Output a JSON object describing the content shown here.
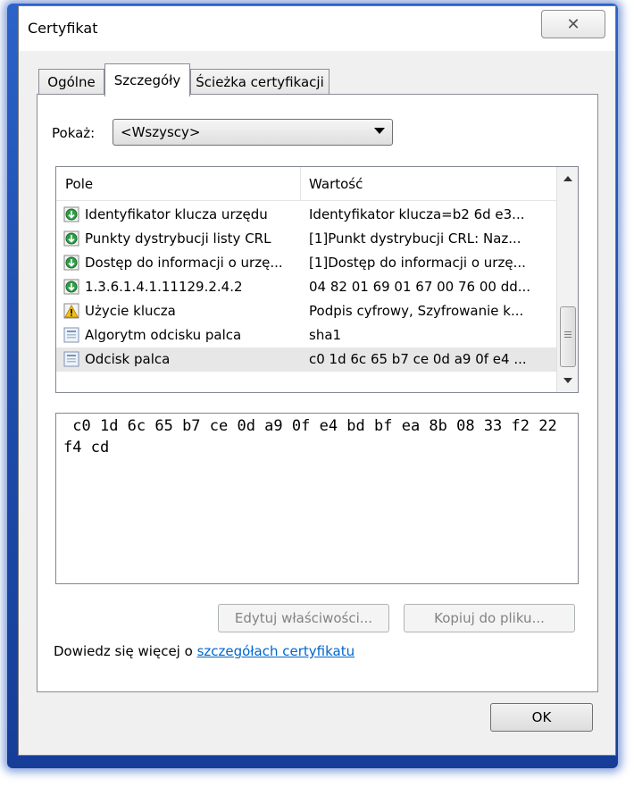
{
  "window": {
    "title": "Certyfikat",
    "close_glyph": "✕"
  },
  "tabs": [
    {
      "label": "Ogólne"
    },
    {
      "label": "Szczegóły",
      "active": true
    },
    {
      "label": "Ścieżka certyfikacji"
    }
  ],
  "show": {
    "label": "Pokaż:",
    "value": "<Wszyscy>"
  },
  "list": {
    "columns": [
      "Pole",
      "Wartość"
    ],
    "rows": [
      {
        "icon": "cert-extension-icon",
        "field": "Identyfikator klucza urzędu",
        "value": "Identyfikator klucza=b2 6d e3..."
      },
      {
        "icon": "cert-extension-icon",
        "field": "Punkty dystrybucji listy CRL",
        "value": "[1]Punkt dystrybucji CRL: Naz..."
      },
      {
        "icon": "cert-extension-icon",
        "field": "Dostęp do informacji o urzę...",
        "value": "[1]Dostęp do informacji o urzę..."
      },
      {
        "icon": "cert-extension-icon",
        "field": "1.3.6.1.4.1.11129.2.4.2",
        "value": "04 82 01 69 01 67 00 76 00 dd..."
      },
      {
        "icon": "warning-icon",
        "field": "Użycie klucza",
        "value": "Podpis cyfrowy, Szyfrowanie k..."
      },
      {
        "icon": "cert-field-icon",
        "field": "Algorytm odcisku palca",
        "value": "sha1"
      },
      {
        "icon": "cert-field-icon",
        "field": "Odcisk palca",
        "value": "c0 1d 6c 65 b7 ce 0d a9 0f e4 ...",
        "selected": true
      }
    ]
  },
  "detail_value": " c0 1d 6c 65 b7 ce 0d a9 0f e4 bd bf ea 8b 08 33 f2 22 f4 cd",
  "buttons": {
    "edit": "Edytuj właściwości...",
    "copy": "Kopiuj do pliku...",
    "ok": "OK"
  },
  "learn_more": {
    "prefix": "Dowiedz się więcej o ",
    "link": "szczegółach certyfikatu"
  },
  "colors": {
    "frame_glow": "#1f4fb0",
    "link": "#0066cc",
    "selection": "#e7e7e7"
  }
}
